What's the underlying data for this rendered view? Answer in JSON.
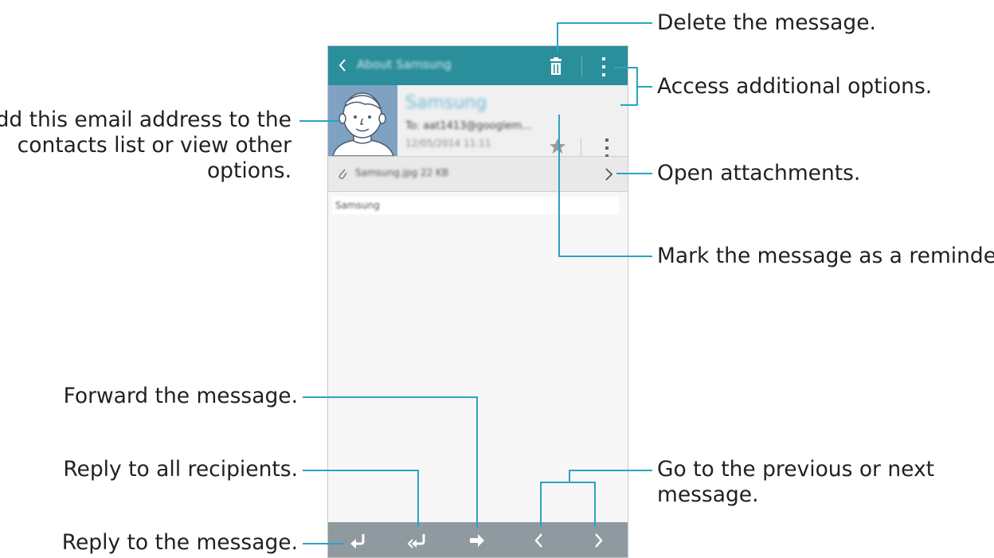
{
  "screen": {
    "title": "About Samsung",
    "sender": "Samsung",
    "to": "To: aat1413@googlem...",
    "date": "12/05/2014 11:11",
    "attachment": "Samsung.jpg  22 KB",
    "body_text": "Samsung",
    "icons": {
      "back": "chevron-left-icon",
      "delete": "trash-icon",
      "more": "more-vertical-icon",
      "star": "star-icon",
      "expand": "chevron-down-icon",
      "attachment": "paperclip-icon",
      "open_attachment": "chevron-right-icon",
      "reply": "reply-icon",
      "reply_all": "reply-all-icon",
      "forward": "forward-icon",
      "previous": "chevron-left-icon",
      "next": "chevron-right-icon"
    },
    "colors": {
      "action_bar": "#2b8e9b",
      "bottom_bar": "#8e9aa0",
      "leader_line": "#29a3c4",
      "avatar_bg": "#7fa2c3"
    }
  },
  "callouts": {
    "delete": "Delete the message.",
    "options": "Access additional options.",
    "contact_line1": "Add this email address to the",
    "contact_line2": "contacts list or view other",
    "contact_line3": "options.",
    "attachments": "Open attachments.",
    "reminder": "Mark the message as a reminder.",
    "forward": "Forward the message.",
    "reply_all": "Reply to all recipients.",
    "reply": "Reply to the message.",
    "prev_next_line1": "Go to the previous or next",
    "prev_next_line2": "message."
  }
}
